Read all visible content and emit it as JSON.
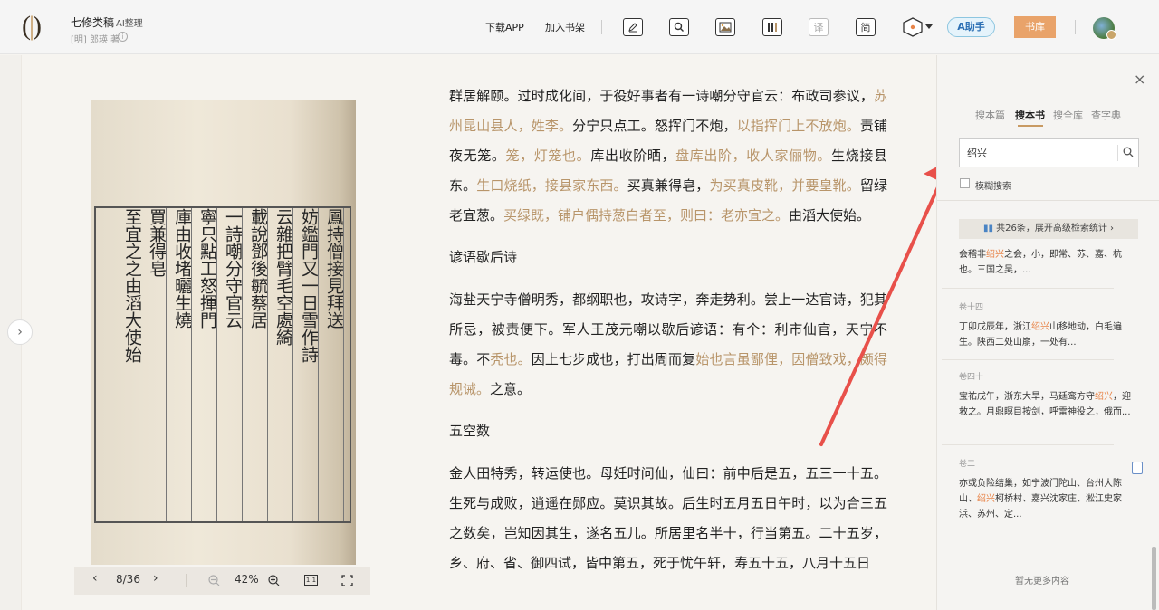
{
  "header": {
    "book_title": "七修类稿",
    "ai_tag": "AI整理",
    "author": "[明] 郎瑛 著",
    "info_icon": "i",
    "links": {
      "download": "下载APP",
      "shelf": "加入书架"
    },
    "tools": {
      "translate": "译",
      "simplified": "简"
    },
    "ai_button": "A助手",
    "library_button": "书库"
  },
  "scan": {
    "columns": [
      "鳳持僧接見拜送",
      "妨鑑門又一日雪作詩",
      "云雜把臂毛空處綺",
      "載說鄧後毓蔡居",
      "一詩嘲分守官云",
      "寧只點工怒揮門",
      "庫由收堵曬生燒",
      "買兼得皂",
      "至宜之之由滔大使始"
    ]
  },
  "pager": {
    "page": "8/36",
    "zoom": "42%",
    "fit": "1:1"
  },
  "text": {
    "p1": [
      {
        "t": "群居解颐。过时成化间，于役好事者有一诗嘲分守官云：布政司参议，",
        "a": false
      },
      {
        "t": "苏州昆山县人，姓李。",
        "a": true
      },
      {
        "t": "分宁只点工。怒挥门不炮，",
        "a": false
      },
      {
        "t": "以指挥门上不放炮。",
        "a": true
      },
      {
        "t": "责铺夜无笼。",
        "a": false
      },
      {
        "t": "笼，灯笼也。",
        "a": true
      },
      {
        "t": "库出收阶晒，",
        "a": false
      },
      {
        "t": "盘库出阶，收人家俪物。",
        "a": true
      },
      {
        "t": "生烧接县东。",
        "a": false
      },
      {
        "t": "生口烧纸，接县家东西。",
        "a": true
      },
      {
        "t": "买真兼得皂，",
        "a": false
      },
      {
        "t": "为买真皮靴，并要皇靴。",
        "a": true
      },
      {
        "t": "留绿老宜葱。",
        "a": false
      },
      {
        "t": "买绿既，铺户偶持葱白者至，则曰：老亦宜之。",
        "a": true
      },
      {
        "t": "由滔大使始。",
        "a": false
      }
    ],
    "h2": "谚语歇后诗",
    "p2": [
      {
        "t": "海盐天宁寺僧明秀，都纲职也，攻诗字，奔走势利。尝上一达官诗，犯其所忌，被责便下。军人王茂元嘲以歇后谚语：有个：利市仙官，天宁不毒。不",
        "a": false
      },
      {
        "t": "秃也。",
        "a": true
      },
      {
        "t": "因上七步成也，打出周而复",
        "a": false
      },
      {
        "t": "始也言虽鄙俚，因僧致戏，颇得规诫。",
        "a": true
      },
      {
        "t": "之意。",
        "a": false
      }
    ],
    "h3": "五空数",
    "p3": "金人田特秀，转运使也。母妊时问仙，仙曰：前中后是五，五三一十五。生死与成败，逍遥在郧应。莫识其故。后生时五月五日午时，以为合三五之数矣，岂知因其生，遂名五儿。所居里名半十，行当第五。二十五岁，乡、府、省、御四试，皆中第五，死于忧午轩，寿五十五，八月十五日"
  },
  "panel": {
    "close": "×",
    "tabs": [
      "搜本篇",
      "搜本书",
      "搜全库",
      "查字典"
    ],
    "search_value": "绍兴",
    "fuzzy_label": "模糊搜索",
    "stats": "共26条，展开高级检索统计 ›",
    "results": [
      {
        "vol": "",
        "pre": "会稽非",
        "hl": "绍兴",
        "post": "之会，小，即常、苏、嘉、杭也。三国之吴，..."
      },
      {
        "vol": "卷十四",
        "pre": "丁卯戊辰年，浙江",
        "hl": "绍兴",
        "post": "山移地动，白毛遍生。陕西二处山崩，一处有..."
      },
      {
        "vol": "卷四十一",
        "pre": "宝祐戊午，浙东大旱，马廷鸾方守",
        "hl": "绍兴",
        "post": "，迎救之。月鼎瞑目按剑，呼雷神役之，俄而..."
      },
      {
        "vol": "卷二",
        "pre": "亦或负险结巢，如宁波门陀山、台州大陈山、",
        "hl": "绍兴",
        "post": "柯桥村、嘉兴沈家庄、淞江史家浜、苏州、定..."
      }
    ],
    "no_more": "暂无更多内容"
  },
  "colors": {
    "accent": "#c89a63",
    "annotation": "#b8956a",
    "highlight": "#e8854a",
    "arrow": "#e8504a"
  }
}
